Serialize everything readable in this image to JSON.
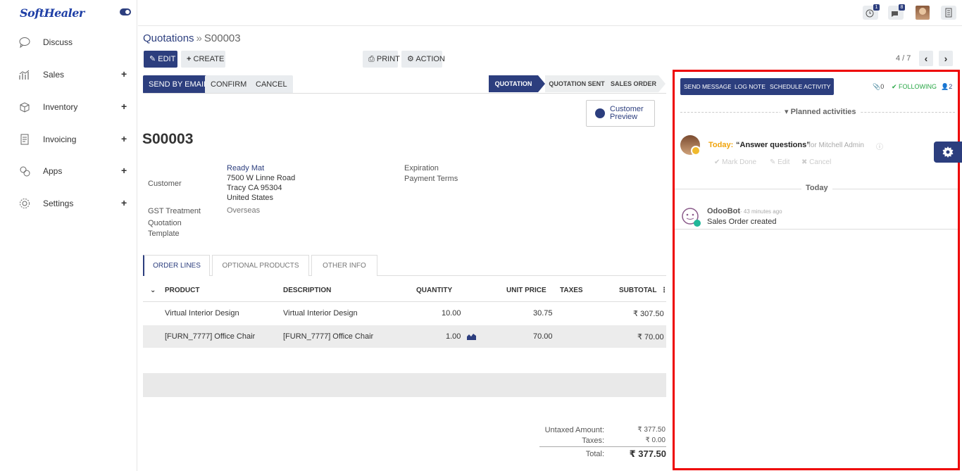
{
  "brand": "SoftHealer",
  "sidebar": {
    "items": [
      {
        "label": "Discuss",
        "icon": "chat-icon",
        "expandable": false
      },
      {
        "label": "Sales",
        "icon": "chart-icon",
        "expandable": true
      },
      {
        "label": "Inventory",
        "icon": "box-icon",
        "expandable": true
      },
      {
        "label": "Invoicing",
        "icon": "invoice-icon",
        "expandable": true
      },
      {
        "label": "Apps",
        "icon": "apps-icon",
        "expandable": true
      },
      {
        "label": "Settings",
        "icon": "gear-icon",
        "expandable": true
      }
    ],
    "plus": "+"
  },
  "topbar": {
    "activity_count": "1",
    "messages_count": "8"
  },
  "breadcrumb": {
    "parent": "Quotations",
    "separator": "»",
    "current": "S00003"
  },
  "control": {
    "edit": "Edit",
    "create": "Create",
    "print": "Print",
    "action": "Action",
    "pager": "4 / 7",
    "prev": "‹",
    "next": "›"
  },
  "header": {
    "send_email": "Send by Email",
    "confirm": "Confirm",
    "cancel": "Cancel",
    "stages": [
      {
        "label": "Quotation",
        "active": true
      },
      {
        "label": "Quotation Sent",
        "active": false
      },
      {
        "label": "Sales Order",
        "active": false
      }
    ]
  },
  "form": {
    "preview_line1": "Customer",
    "preview_line2": "Preview",
    "name": "S00003",
    "customer_label": "Customer",
    "customer_name": "Ready Mat",
    "customer_addr1": "7500 W Linne Road",
    "customer_addr2": "Tracy CA 95304",
    "customer_addr3": "United States",
    "gst_label": "GST Treatment",
    "gst_value": "Overseas",
    "template_label1": "Quotation",
    "template_label2": "Template",
    "expiration_label": "Expiration",
    "payment_terms_label": "Payment Terms"
  },
  "notebook": {
    "tabs": [
      "Order Lines",
      "Optional Products",
      "Other Info"
    ]
  },
  "order_lines": {
    "headers": {
      "product": "Product",
      "description": "Description",
      "quantity": "Quantity",
      "unit_price": "Unit Price",
      "taxes": "Taxes",
      "subtotal": "Subtotal"
    },
    "rows": [
      {
        "product": "Virtual Interior Design",
        "description": "Virtual Interior Design",
        "quantity": "10.00",
        "unit_price": "30.75",
        "taxes": "",
        "subtotal": "₹ 307.50"
      },
      {
        "product": "[FURN_7777] Office Chair",
        "description": "[FURN_7777] Office Chair",
        "quantity": "1.00",
        "unit_price": "70.00",
        "taxes": "",
        "subtotal": "₹ 70.00"
      }
    ]
  },
  "totals": {
    "untaxed_label": "Untaxed Amount:",
    "untaxed_value": "₹ 377.50",
    "taxes_label": "Taxes:",
    "taxes_value": "₹ 0.00",
    "total_label": "Total:",
    "total_value": "₹ 377.50"
  },
  "chatter": {
    "send_message": "Send Message",
    "log_note": "Log Note",
    "schedule_activity": "Schedule Activity",
    "attachments": "0",
    "following": "Following",
    "followers": "2",
    "planned_title": "Planned activities",
    "activity_when": "Today:",
    "activity_summary": "“Answer questions”",
    "activity_for": "for Mitchell Admin",
    "mark_done": "Mark Done",
    "edit": "Edit",
    "cancel": "Cancel",
    "today_divider": "Today",
    "msg_author": "OdooBot",
    "msg_time": "- 43 minutes ago",
    "msg_body": "Sales Order created"
  },
  "colors": {
    "primary": "#2c3e7e",
    "highlight_border": "#e00000",
    "following": "#28a745",
    "today": "#f0a30a"
  }
}
